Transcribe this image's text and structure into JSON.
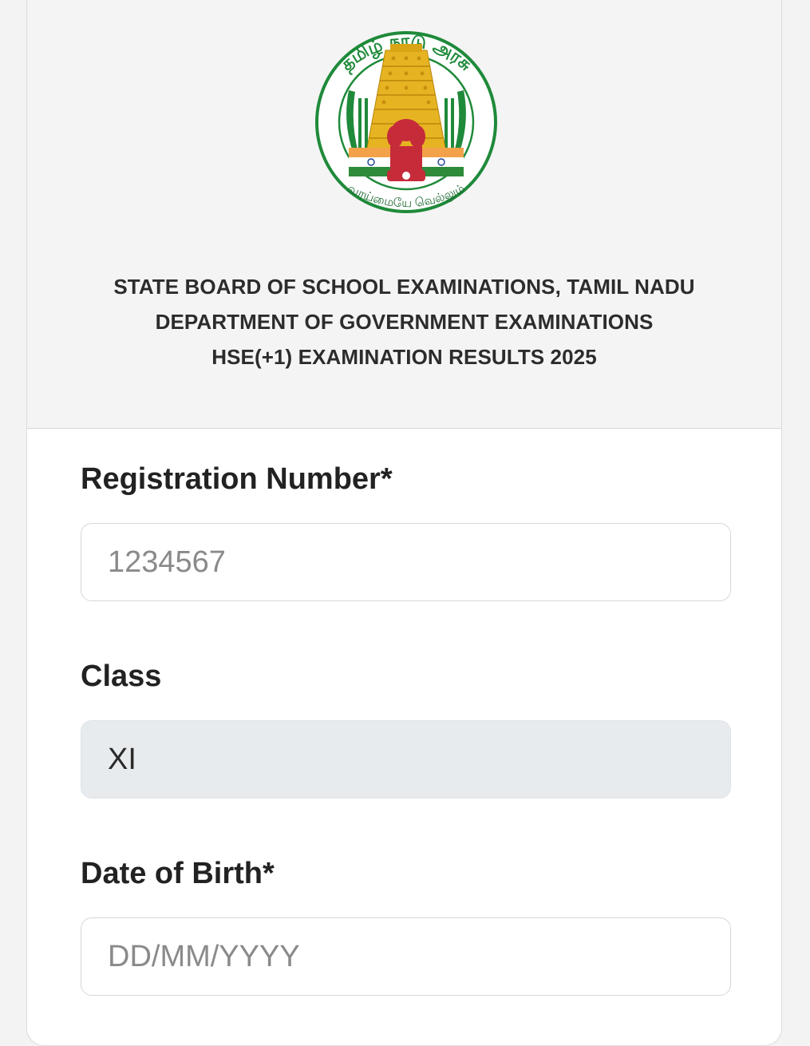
{
  "header": {
    "emblem": {
      "name": "tamil-nadu-government-emblem",
      "top_text": "தமிழ் நாடு அரசு",
      "motto": "வாய்மையே வெல்லும்"
    },
    "title_line1": "STATE BOARD OF SCHOOL EXAMINATIONS, TAMIL NADU",
    "title_line2": "DEPARTMENT OF GOVERNMENT EXAMINATIONS",
    "title_line3": "HSE(+1) EXAMINATION RESULTS 2025"
  },
  "form": {
    "registration": {
      "label": "Registration Number*",
      "placeholder": "1234567",
      "value": ""
    },
    "class": {
      "label": "Class",
      "value": "XI"
    },
    "dob": {
      "label": "Date of Birth*",
      "placeholder": "DD/MM/YYYY",
      "value": ""
    }
  },
  "colors": {
    "emblem_green": "#1f8a3a",
    "emblem_gold": "#e6b422",
    "saffron": "#f4a24a",
    "india_green": "#2e8b3a",
    "ashoka_blue": "#1c3f94",
    "lion_red": "#c62b3a"
  }
}
